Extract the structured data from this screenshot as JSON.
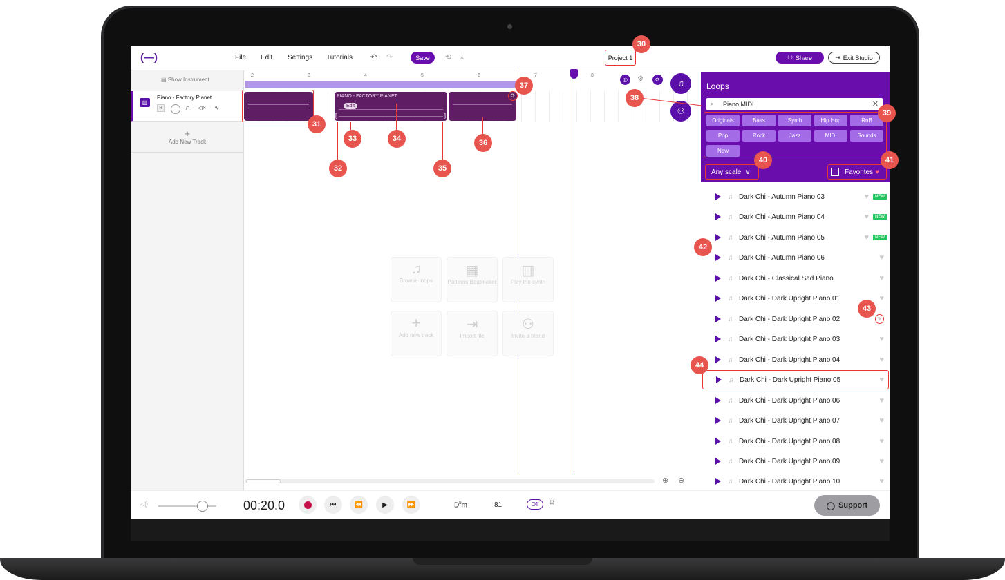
{
  "topbar": {
    "logo": "(—)",
    "menu": [
      "File",
      "Edit",
      "Settings",
      "Tutorials"
    ],
    "save": "Save",
    "project": "Project 1",
    "share": "Share",
    "exit": "Exit Studio"
  },
  "left": {
    "show_instrument": "Show Instrument",
    "track_name": "Piano - Factory Pianet",
    "r": "R",
    "add_track": "Add New Track"
  },
  "ruler": [
    "2",
    "3",
    "4",
    "5",
    "6",
    "7",
    "8"
  ],
  "clip": {
    "label": "PIANO - FACTORY PIANET",
    "edit": "Edit"
  },
  "overlay": [
    {
      "t": "Browse loops"
    },
    {
      "t": "Patterns Beatmaker"
    },
    {
      "t": "Play the synth"
    },
    {
      "t": "Add new track"
    },
    {
      "t": "Import file"
    },
    {
      "t": "Invite a friend"
    }
  ],
  "loops": {
    "title": "Loops",
    "search": "Piano MIDI",
    "genres": [
      "Originals",
      "Bass",
      "Synth",
      "Hip Hop",
      "RnB",
      "Pop",
      "Rock",
      "Jazz",
      "MIDI",
      "Sounds",
      "New"
    ],
    "scale": "Any scale",
    "favorites": "Favorites",
    "new_label": "NEW",
    "items": [
      "Dark Chi - Autumn Piano 03",
      "Dark Chi - Autumn Piano 04",
      "Dark Chi - Autumn Piano 05",
      "Dark Chi - Autumn Piano 06",
      "Dark Chi - Classical Sad Piano",
      "Dark Chi - Dark Upright Piano 01",
      "Dark Chi - Dark Upright Piano 02",
      "Dark Chi - Dark Upright Piano 03",
      "Dark Chi - Dark Upright Piano 04",
      "Dark Chi - Dark Upright Piano 05",
      "Dark Chi - Dark Upright Piano 06",
      "Dark Chi - Dark Upright Piano 07",
      "Dark Chi - Dark Upright Piano 08",
      "Dark Chi - Dark Upright Piano 09",
      "Dark Chi - Dark Upright Piano 10"
    ]
  },
  "transport": {
    "time": "00:20.0",
    "key_root": "D",
    "key_flat": "b",
    "key_mode": "m",
    "bpm": "81",
    "off": "Off",
    "support": "Support"
  },
  "badges": [
    "30",
    "31",
    "32",
    "33",
    "34",
    "35",
    "36",
    "37",
    "38",
    "39",
    "40",
    "41",
    "42",
    "43",
    "44"
  ]
}
